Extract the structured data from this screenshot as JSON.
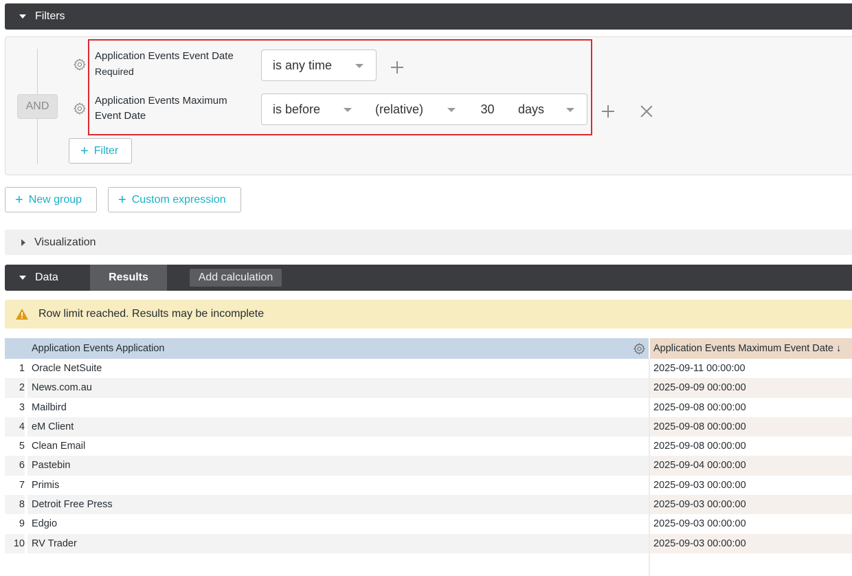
{
  "filters_section": {
    "title": "Filters"
  },
  "filters": {
    "logic_label": "AND",
    "rows": [
      {
        "field_line1": "Application Events Event Date",
        "field_line2": "Required",
        "operator": "is any time"
      },
      {
        "field_line1": "Application Events Maximum",
        "field_line2": "Event Date",
        "operator": "is before",
        "mode": "(relative)",
        "value": "30",
        "unit": "days"
      }
    ],
    "add_filter_label": "Filter"
  },
  "group_buttons": {
    "new_group": "New group",
    "custom_expression": "Custom expression"
  },
  "visualization_section": {
    "title": "Visualization"
  },
  "data_section": {
    "title": "Data",
    "results_tab": "Results",
    "add_calculation": "Add calculation"
  },
  "warning": {
    "text": "Row limit reached. Results may be incomplete"
  },
  "table": {
    "headers": {
      "application": "Application Events Application",
      "date": "Application Events Maximum Event Date ↓"
    },
    "rows": [
      {
        "index": "1",
        "application": "Oracle NetSuite",
        "date": "2025-09-11 00:00:00"
      },
      {
        "index": "2",
        "application": "News.com.au",
        "date": "2025-09-09 00:00:00"
      },
      {
        "index": "3",
        "application": "Mailbird",
        "date": "2025-09-08 00:00:00"
      },
      {
        "index": "4",
        "application": "eM Client",
        "date": "2025-09-08 00:00:00"
      },
      {
        "index": "5",
        "application": "Clean Email",
        "date": "2025-09-08 00:00:00"
      },
      {
        "index": "6",
        "application": "Pastebin",
        "date": "2025-09-04 00:00:00"
      },
      {
        "index": "7",
        "application": "Primis",
        "date": "2025-09-03 00:00:00"
      },
      {
        "index": "8",
        "application": "Detroit Free Press",
        "date": "2025-09-03 00:00:00"
      },
      {
        "index": "9",
        "application": "Edgio",
        "date": "2025-09-03 00:00:00"
      },
      {
        "index": "10",
        "application": "RV Trader",
        "date": "2025-09-03 00:00:00"
      }
    ]
  },
  "colors": {
    "accent": "#1ab0c7",
    "highlight": "#e0282d",
    "section_bar": "#3a3c3f",
    "warning_bg": "#f7edc1"
  },
  "icons": [
    "caret-down-icon",
    "caret-right-icon",
    "gear-icon",
    "plus-icon",
    "close-icon",
    "warning-icon",
    "sort-down-icon"
  ]
}
